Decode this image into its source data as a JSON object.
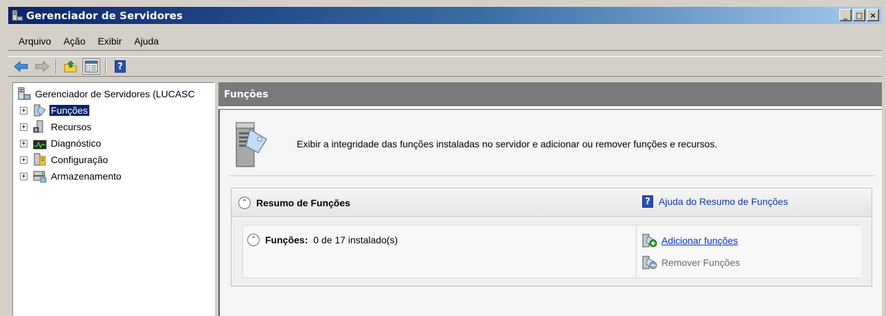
{
  "window": {
    "title": "Gerenciador de Servidores",
    "minimize": "_",
    "maximize": "□",
    "close": "×"
  },
  "menu": {
    "items": [
      "Arquivo",
      "Ação",
      "Exibir",
      "Ajuda"
    ]
  },
  "toolbar": {
    "help_glyph": "?"
  },
  "tree": {
    "root_label": "Gerenciador de Servidores (LUCASC",
    "expander": "+",
    "items": [
      {
        "label": "Funções",
        "selected": true
      },
      {
        "label": "Recursos",
        "selected": false
      },
      {
        "label": "Diagnóstico",
        "selected": false
      },
      {
        "label": "Configuração",
        "selected": false
      },
      {
        "label": "Armazenamento",
        "selected": false
      }
    ]
  },
  "main": {
    "header_title": "Funções",
    "intro_text": "Exibir a integridade das funções instaladas no servidor e adicionar ou remover funções e recursos.",
    "panel": {
      "title": "Resumo de Funções",
      "help_link": "Ajuda do Resumo de Funções",
      "help_glyph": "?",
      "summary_label": "Funções:",
      "summary_value": "0 de 17 instalado(s)",
      "actions": {
        "add": "Adicionar funções",
        "remove": "Remover Funções"
      }
    },
    "collapse_glyph": "⌃"
  },
  "colors": {
    "title_gradient_start": "#0a246a",
    "selection": "#0a246a",
    "header_gray": "#7a7a7a",
    "link_blue": "#0033cc"
  }
}
